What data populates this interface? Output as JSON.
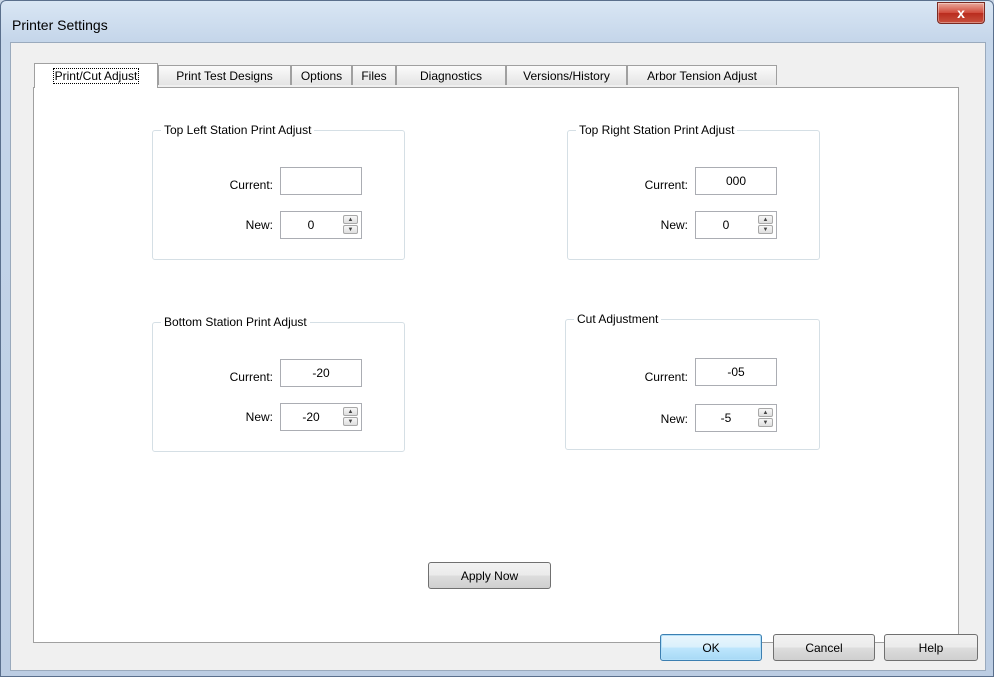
{
  "window": {
    "title": "Printer Settings",
    "close_glyph": "x"
  },
  "tabs": [
    {
      "label": "Print/Cut Adjust",
      "active": true
    },
    {
      "label": "Print Test Designs",
      "active": false
    },
    {
      "label": "Options",
      "active": false
    },
    {
      "label": "Files",
      "active": false
    },
    {
      "label": "Diagnostics",
      "active": false
    },
    {
      "label": "Versions/History",
      "active": false
    },
    {
      "label": "Arbor Tension Adjust",
      "active": false
    }
  ],
  "groups": {
    "top_left": {
      "title": "Top Left Station Print Adjust",
      "current_label": "Current:",
      "current_value": "",
      "new_label": "New:",
      "new_value": "0"
    },
    "top_right": {
      "title": "Top Right Station Print Adjust",
      "current_label": "Current:",
      "current_value": "000",
      "new_label": "New:",
      "new_value": "0"
    },
    "bottom": {
      "title": "Bottom Station Print Adjust",
      "current_label": "Current:",
      "current_value": "-20",
      "new_label": "New:",
      "new_value": "-20"
    },
    "cut": {
      "title": "Cut Adjustment",
      "current_label": "Current:",
      "current_value": "-05",
      "new_label": "New:",
      "new_value": "-5"
    }
  },
  "spin_glyphs": {
    "up": "▲",
    "down": "▼"
  },
  "buttons": {
    "apply": "Apply Now",
    "ok": "OK",
    "cancel": "Cancel",
    "help": "Help"
  }
}
